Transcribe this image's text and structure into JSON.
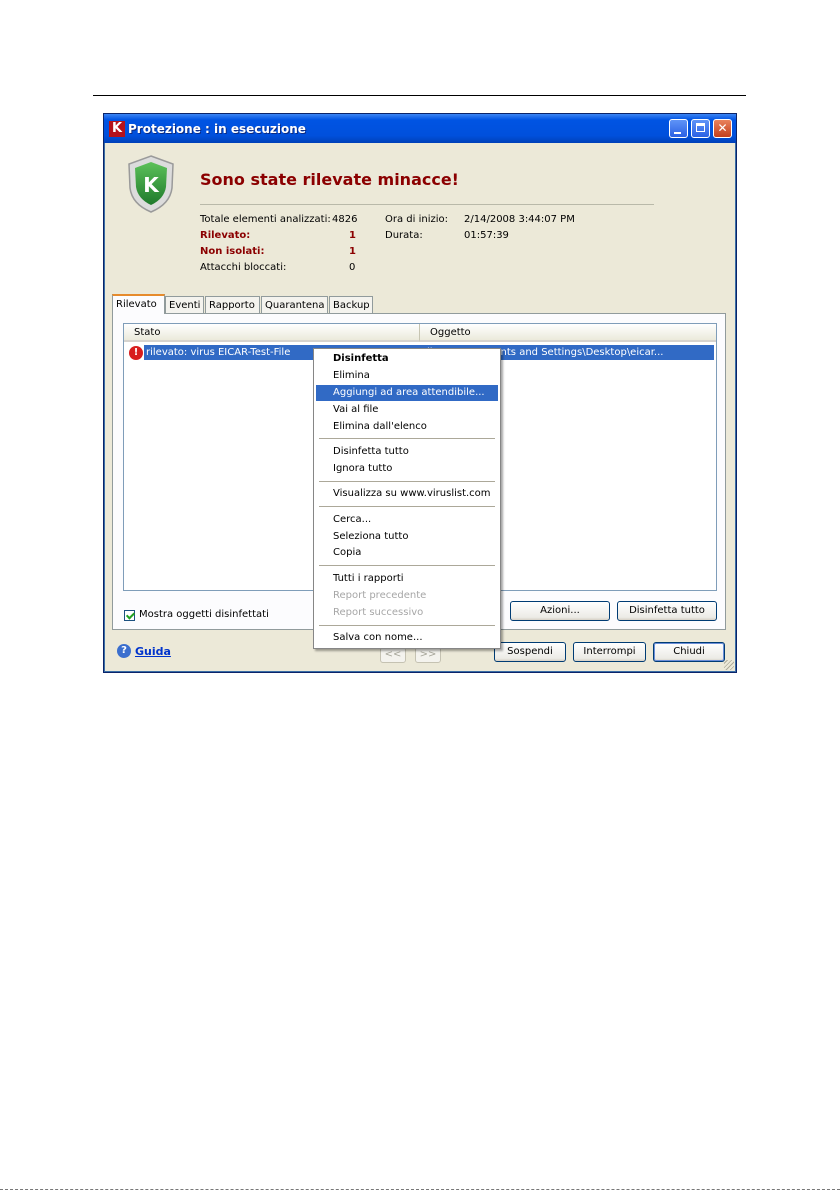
{
  "window": {
    "title": "Protezione : in esecuzione",
    "logo": "K",
    "controls": {
      "minimize": "minimize-icon",
      "maximize": "maximize-icon",
      "close": "✕"
    }
  },
  "header": {
    "headline": "Sono state rilevate minacce!",
    "shield_letter": "K"
  },
  "stats": {
    "total_label": "Totale elementi analizzati:",
    "total_value": "4826",
    "detected_label": "Rilevato:",
    "detected_value": "1",
    "not_isolated_label": "Non isolati:",
    "not_isolated_value": "1",
    "blocked_label": "Attacchi bloccati:",
    "blocked_value": "0",
    "start_label": "Ora di inizio:",
    "start_value": "2/14/2008 3:44:07 PM",
    "duration_label": "Durata:",
    "duration_value": "01:57:39"
  },
  "tabs": [
    "Rilevato",
    "Eventi",
    "Rapporto",
    "Quarantena",
    "Backup"
  ],
  "table": {
    "columns": [
      "Stato",
      "Oggetto"
    ],
    "rows": [
      {
        "status": "rilevato: virus EICAR-Test-File",
        "object": "File: C:\\Documents and Settings\\Desktop\\eicar..."
      }
    ]
  },
  "checkbox": {
    "label": "Mostra oggetti disinfettati",
    "checked": true
  },
  "buttons": {
    "actions": "Azioni...",
    "disinfect_all": "Disinfetta tutto",
    "prev": "<<",
    "next": ">>",
    "suspend": "Sospendi",
    "stop": "Interrompi",
    "close": "Chiudi"
  },
  "help": {
    "icon": "?",
    "label": "Guida"
  },
  "context_menu": {
    "items": [
      "Disinfetta",
      "Elimina",
      "Aggiungi ad area attendibile...",
      "Vai al file",
      "Elimina dall'elenco",
      "Disinfetta tutto",
      "Ignora tutto",
      "Visualizza su www.viruslist.com",
      "Cerca...",
      "Seleziona tutto",
      "Copia",
      "Tutti i rapporti",
      "Report precedente",
      "Report successivo",
      "Salva con nome..."
    ],
    "highlighted": "Aggiungi ad area attendibile..."
  },
  "colors": {
    "title_bar": "#0054e3",
    "headline": "#8b0000",
    "selection": "#316ac5",
    "shield_green": "#2f8f3a"
  }
}
